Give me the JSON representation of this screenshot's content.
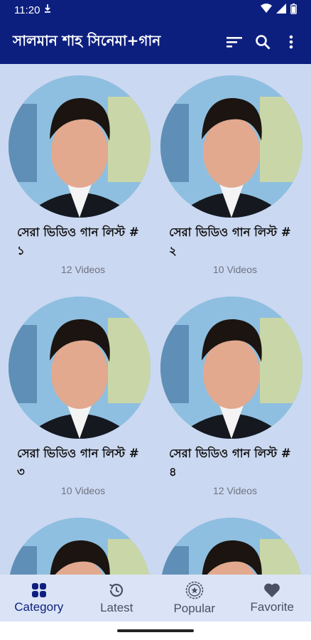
{
  "status_bar": {
    "time": "11:20",
    "icons": [
      "download-icon",
      "wifi-icon",
      "signal-icon",
      "battery-icon"
    ]
  },
  "app_bar": {
    "title": "সালমান শাহ সিনেমা+গান",
    "actions": [
      "sort-icon",
      "search-icon",
      "more-vert-icon"
    ]
  },
  "cards": [
    {
      "title": "সেরা ভিডিও গান লিস্ট # ১",
      "count": "12 Videos"
    },
    {
      "title": "সেরা ভিডিও গান লিস্ট # ২",
      "count": "10 Videos"
    },
    {
      "title": "সেরা ভিডিও গান লিস্ট # ৩",
      "count": "10 Videos"
    },
    {
      "title": "সেরা ভিডিও গান লিস্ট # ৪",
      "count": "12 Videos"
    }
  ],
  "bottom_nav": {
    "items": [
      {
        "label": "Category",
        "icon": "grid-icon",
        "active": true
      },
      {
        "label": "Latest",
        "icon": "history-icon",
        "active": false
      },
      {
        "label": "Popular",
        "icon": "star-badge-icon",
        "active": false
      },
      {
        "label": "Favorite",
        "icon": "heart-icon",
        "active": false
      }
    ]
  },
  "colors": {
    "primary": "#0d1f7e",
    "content_background": "#cbd8f1",
    "nav_background": "#dbe4f6"
  }
}
